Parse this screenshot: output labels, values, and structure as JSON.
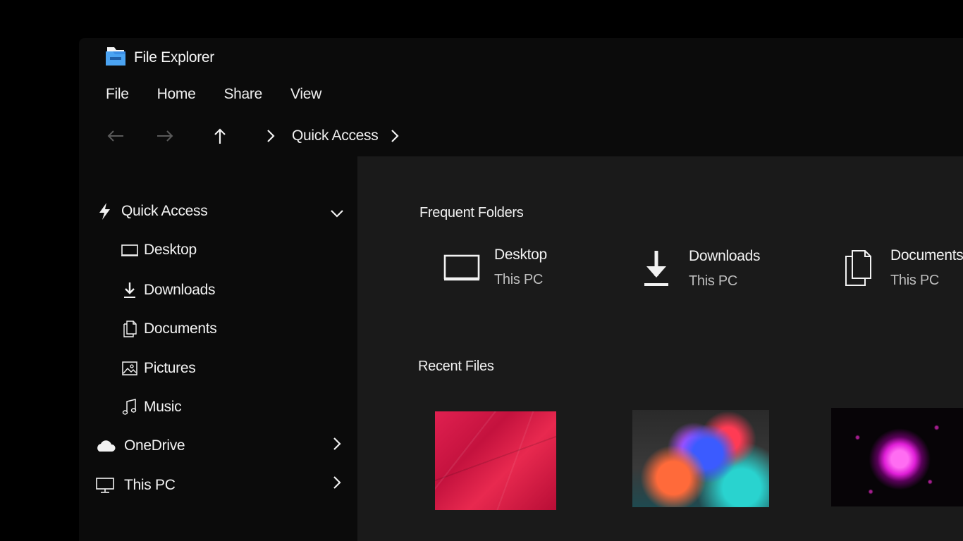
{
  "app": {
    "title": "File Explorer",
    "icon": "folder-app-icon",
    "accent": "#3a8ee6"
  },
  "menu": {
    "items": [
      {
        "label": "File"
      },
      {
        "label": "Home"
      },
      {
        "label": "Share"
      },
      {
        "label": "View"
      }
    ]
  },
  "address": {
    "back_icon": "arrow-left-icon",
    "forward_icon": "arrow-right-icon",
    "up_icon": "arrow-up-icon",
    "crumb": "Quick Access"
  },
  "sidebar": {
    "quick_access": "Quick Access",
    "items": [
      {
        "label": "Desktop",
        "icon": "desktop-icon"
      },
      {
        "label": "Downloads",
        "icon": "download-icon"
      },
      {
        "label": "Documents",
        "icon": "documents-icon"
      },
      {
        "label": "Pictures",
        "icon": "pictures-icon"
      },
      {
        "label": "Music",
        "icon": "music-icon"
      }
    ],
    "onedrive": "OneDrive",
    "thispc": "This PC"
  },
  "content": {
    "frequent_title": "Frequent Folders",
    "folders": [
      {
        "name": "Desktop",
        "location": "This PC"
      },
      {
        "name": "Downloads",
        "location": "This PC"
      },
      {
        "name": "Documents",
        "location": "This PC"
      }
    ],
    "recent_title": "Recent Files"
  }
}
